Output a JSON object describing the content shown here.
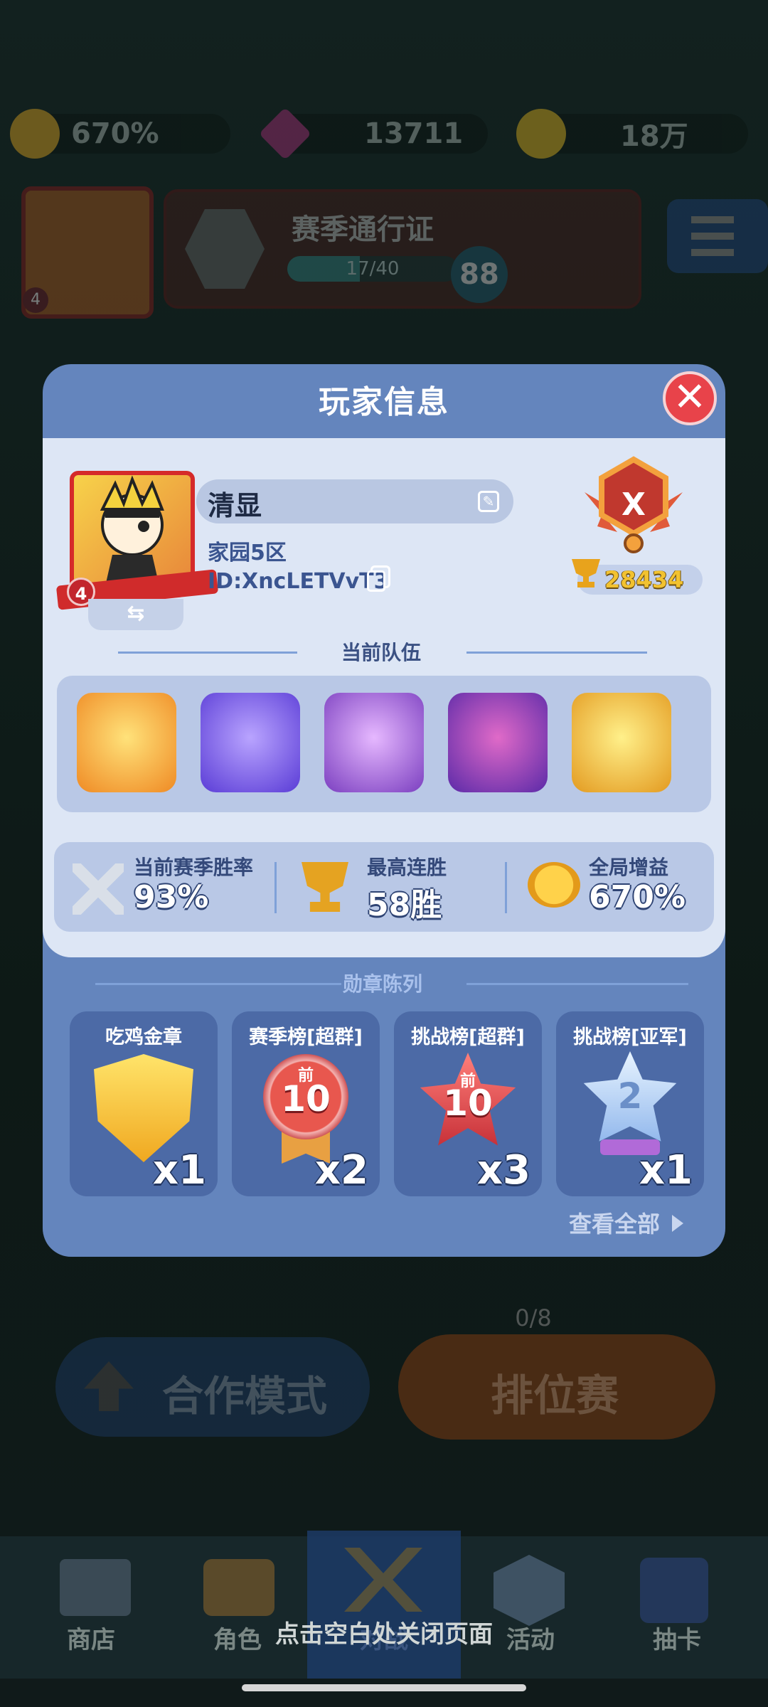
{
  "hud": {
    "bonus_percent": "670%",
    "gems": "13711",
    "gold": "18万",
    "avatar_level": "4",
    "season_pass": {
      "title": "赛季通行证",
      "progress": "17/40",
      "level": "88"
    }
  },
  "modal": {
    "title": "玩家信息",
    "close_label": "✕",
    "player": {
      "name": "清显",
      "server": "家园5区",
      "id": "ID:XncLETVvT3",
      "avatar_level": "4",
      "rank_letter": "X",
      "trophies": "28434"
    },
    "team_title": "当前队伍",
    "stats": [
      {
        "label": "当前赛季胜率",
        "value": "93%"
      },
      {
        "label": "最高连胜",
        "value": "58胜"
      },
      {
        "label": "全局增益",
        "value": "670%"
      }
    ],
    "medals_title": "勋章陈列",
    "medals": [
      {
        "title": "吃鸡金章",
        "count": "x1",
        "badge_text": ""
      },
      {
        "title": "赛季榜[超群]",
        "count": "x2",
        "badge_top": "前",
        "badge_text": "10"
      },
      {
        "title": "挑战榜[超群]",
        "count": "x3",
        "badge_top": "前",
        "badge_text": "10"
      },
      {
        "title": "挑战榜[亚军]",
        "count": "x1",
        "badge_text": "2"
      }
    ],
    "view_all": "查看全部"
  },
  "lobby": {
    "coop_mode": "合作模式",
    "ranked": "排位赛",
    "ranked_progress": "0/8"
  },
  "bottom_nav": [
    "商店",
    "角色",
    "对战",
    "活动",
    "抽卡"
  ],
  "close_hint": "点击空白处关闭页面",
  "colors": {
    "modal_blue": "#6485bd",
    "card_bg": "#dde6f5",
    "close_red": "#e8434a",
    "trophy_gold": "#f2c230"
  }
}
